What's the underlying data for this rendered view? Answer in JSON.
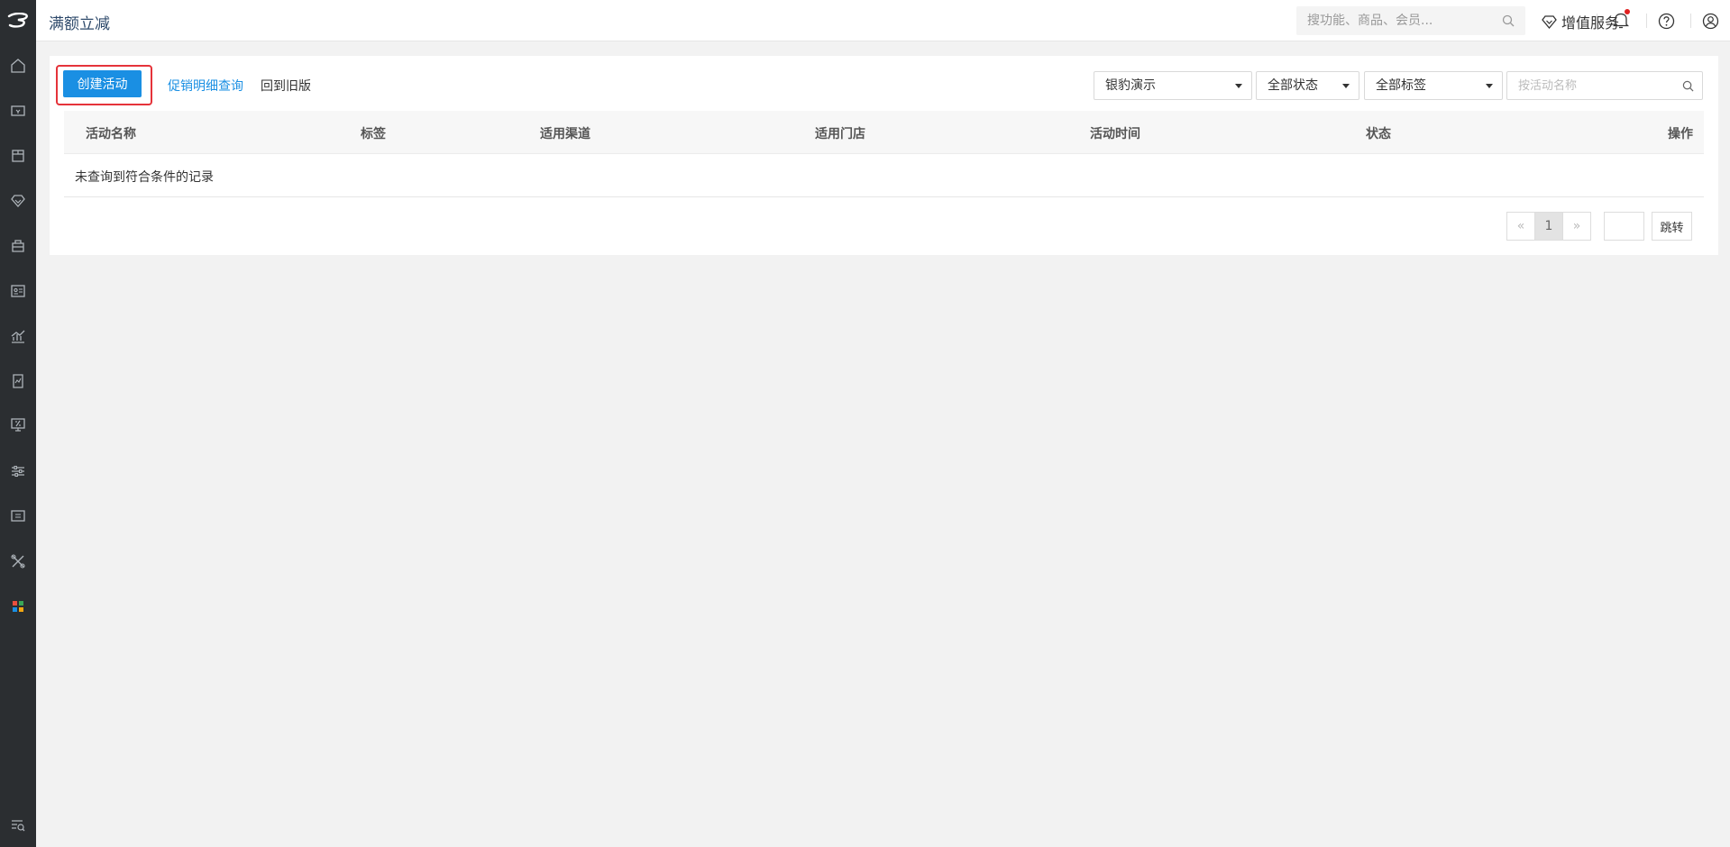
{
  "header": {
    "title": "满额立减",
    "search_placeholder": "搜功能、商品、会员...",
    "value_added_services": "增值服务"
  },
  "sidebar": {
    "items": [
      {
        "icon": "home-icon"
      },
      {
        "icon": "cashier-icon"
      },
      {
        "icon": "goods-icon"
      },
      {
        "icon": "member-icon"
      },
      {
        "icon": "store-icon"
      },
      {
        "icon": "employee-card-icon"
      },
      {
        "icon": "report-chart-icon"
      },
      {
        "icon": "finance-document-icon"
      },
      {
        "icon": "marketing-discount-icon"
      },
      {
        "icon": "settings-sliders-icon"
      },
      {
        "icon": "card-icon"
      },
      {
        "icon": "tools-icon"
      },
      {
        "icon": "apps-grid-icon"
      }
    ],
    "bottom_icon": "menu-search-icon"
  },
  "toolbar": {
    "create_label": "创建活动",
    "promo_detail_label": "促销明细查询",
    "old_version_label": "回到旧版"
  },
  "filters": {
    "store": "银豹演示",
    "status": "全部状态",
    "tag": "全部标签",
    "name_placeholder": "按活动名称"
  },
  "table": {
    "columns": [
      "活动名称",
      "标签",
      "适用渠道",
      "适用门店",
      "活动时间",
      "状态",
      "操作"
    ],
    "rows": [],
    "empty_text": "未查询到符合条件的记录"
  },
  "pagination": {
    "prev": "«",
    "current": "1",
    "next": "»",
    "jump_label": "跳转"
  },
  "colors": {
    "primary": "#1a8fe3",
    "sidebar_bg": "#2b2e31",
    "highlight": "#e5333a",
    "notify_dot": "#e02020"
  }
}
